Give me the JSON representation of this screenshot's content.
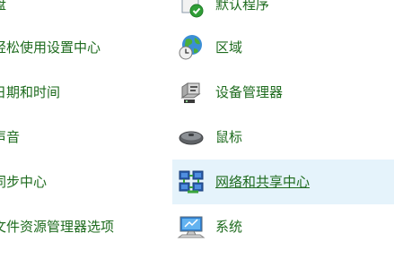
{
  "left_items": [
    {
      "label": "盘"
    },
    {
      "label": "轻松使用设置中心"
    },
    {
      "label": "日期和时间"
    },
    {
      "label": "声音"
    },
    {
      "label": "同步中心"
    },
    {
      "label": "文件资源管理器选项"
    }
  ],
  "right_items": [
    {
      "label": "默认程序",
      "icon": "default-programs-icon"
    },
    {
      "label": "区域",
      "icon": "region-globe-icon"
    },
    {
      "label": "设备管理器",
      "icon": "device-manager-icon"
    },
    {
      "label": "鼠标",
      "icon": "mouse-icon"
    },
    {
      "label": "网络和共享中心",
      "icon": "network-sharing-icon",
      "hovered": true
    },
    {
      "label": "系统",
      "icon": "system-monitor-icon"
    }
  ],
  "colors": {
    "link_text": "#1e6b1e",
    "hover_background": "#e5f3fb",
    "background": "#ffffff"
  }
}
